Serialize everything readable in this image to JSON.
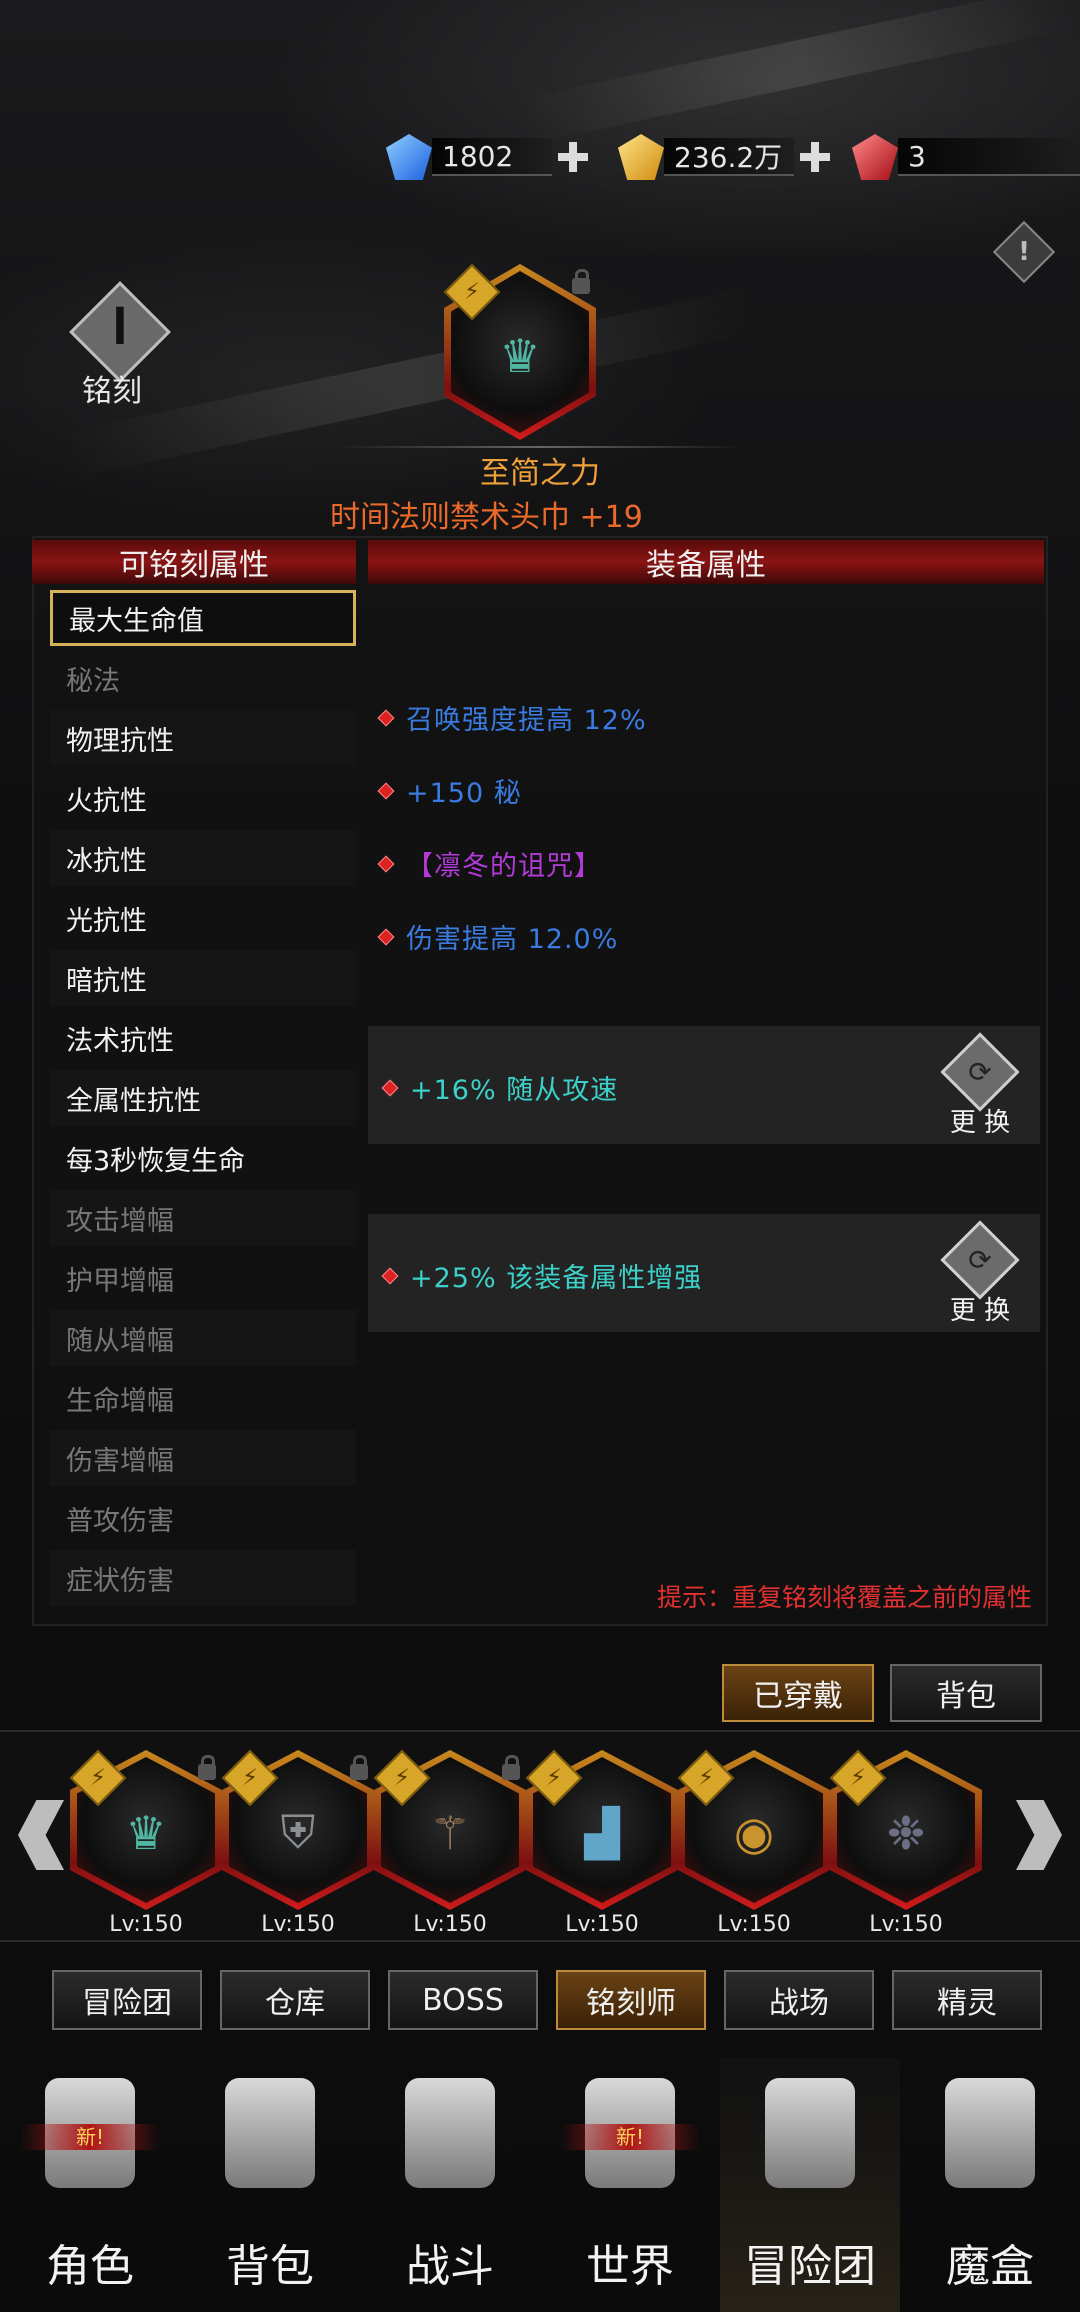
{
  "currency": [
    {
      "icon": "blue-crystal-icon",
      "value": "1802",
      "has_plus": true,
      "color": "#3a8cff"
    },
    {
      "icon": "gold-crystal-icon",
      "value": "236.2万",
      "has_plus": true,
      "color": "#e7b21e"
    },
    {
      "icon": "red-crystal-icon",
      "value": "3",
      "has_plus": false,
      "color": "#d1232b"
    }
  ],
  "info_icon": "!",
  "engrave": {
    "label": "铭刻",
    "glyph": "ꟾ"
  },
  "item": {
    "title": "至简之力",
    "subtitle": "时间法则禁术头巾 +19"
  },
  "headers": {
    "left": "可铭刻属性",
    "right": "装备属性"
  },
  "attributes": [
    {
      "label": "最大生命值",
      "state": "selected"
    },
    {
      "label": "秘法",
      "state": "dim"
    },
    {
      "label": "物理抗性",
      "state": "normal"
    },
    {
      "label": "火抗性",
      "state": "normal"
    },
    {
      "label": "冰抗性",
      "state": "normal"
    },
    {
      "label": "光抗性",
      "state": "normal"
    },
    {
      "label": "暗抗性",
      "state": "normal"
    },
    {
      "label": "法术抗性",
      "state": "normal"
    },
    {
      "label": "全属性抗性",
      "state": "normal"
    },
    {
      "label": "每3秒恢复生命",
      "state": "normal"
    },
    {
      "label": "攻击增幅",
      "state": "dim"
    },
    {
      "label": "护甲增幅",
      "state": "dim"
    },
    {
      "label": "随从增幅",
      "state": "dim"
    },
    {
      "label": "生命增幅",
      "state": "dim"
    },
    {
      "label": "伤害增幅",
      "state": "dim"
    },
    {
      "label": "普攻伤害",
      "state": "dim"
    },
    {
      "label": "症状伤害",
      "state": "dim"
    }
  ],
  "equipment_props": [
    {
      "text": "召唤强度提高 12%",
      "color": "#3a7be0"
    },
    {
      "text": "+150 秘",
      "color": "#3a7be0"
    },
    {
      "text": "【凛冬的诅咒】",
      "color": "#b23ad8"
    },
    {
      "text": "伤害提高 12.0%",
      "color": "#3a7be0"
    }
  ],
  "engraved_props": [
    {
      "text": "+16% 随从攻速",
      "button": "更 换"
    },
    {
      "text": "+25% 该装备属性增强",
      "button": "更 换"
    }
  ],
  "tip": "提示：重复铭刻将覆盖之前的属性",
  "action_buttons": {
    "equipped": "已穿戴",
    "bag": "背包"
  },
  "slots": [
    {
      "name": "helm",
      "level": "Lv:150",
      "icon": "crown-icon"
    },
    {
      "name": "armor",
      "level": "Lv:150",
      "icon": "armor-icon"
    },
    {
      "name": "weapon",
      "level": "Lv:150",
      "icon": "staff-icon"
    },
    {
      "name": "boots",
      "level": "Lv:150",
      "icon": "boot-icon"
    },
    {
      "name": "ring",
      "level": "Lv:150",
      "icon": "ring-icon"
    },
    {
      "name": "cape",
      "level": "Lv:150",
      "icon": "octopus-icon"
    }
  ],
  "sub_tabs": [
    "冒险团",
    "仓库",
    "BOSS",
    "铭刻师",
    "战场",
    "精灵"
  ],
  "active_sub_tab": "铭刻师",
  "nav": [
    {
      "label": "角色",
      "new": true,
      "new_label": "新!"
    },
    {
      "label": "背包",
      "new": false
    },
    {
      "label": "战斗",
      "new": false
    },
    {
      "label": "世界",
      "new": true,
      "new_label": "新!"
    },
    {
      "label": "冒险团",
      "new": false,
      "active": true
    },
    {
      "label": "魔盒",
      "new": false
    }
  ]
}
